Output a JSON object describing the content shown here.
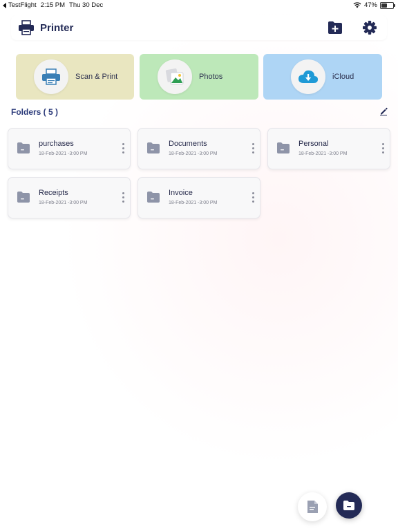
{
  "status_bar": {
    "back_app": "TestFlight",
    "time": "2:15 PM",
    "date": "Thu 30 Dec",
    "battery": "47%",
    "battery_level": 0.47
  },
  "header": {
    "title": "Printer",
    "logo_icon": "printer-icon",
    "add_folder_icon": "folder-plus-icon",
    "settings_icon": "gear-icon",
    "accent": "#232a56"
  },
  "quick_actions": [
    {
      "label": "Scan & Print",
      "icon": "printer-icon",
      "color": "#e9e6c0"
    },
    {
      "label": "Photos",
      "icon": "photos-icon",
      "color": "#bde8b9"
    },
    {
      "label": "iCloud",
      "icon": "cloud-download-icon",
      "color": "#aed5f5"
    }
  ],
  "folders": {
    "title": "Folders ( 5 )",
    "edit_icon": "pencil-icon",
    "items": [
      {
        "name": "purchases",
        "date": "18-Feb-2021 -3:00 PM"
      },
      {
        "name": "Documents",
        "date": "18-Feb-2021 -3:00 PM"
      },
      {
        "name": "Personal",
        "date": "18-Feb-2021 -3:00 PM"
      },
      {
        "name": "Receipts",
        "date": "18-Feb-2021 -3:00 PM"
      },
      {
        "name": "Invoice",
        "date": "18-Feb-2021 -3:00 PM"
      }
    ]
  },
  "fabs": {
    "document_icon": "document-icon",
    "folder_icon": "folder-icon"
  }
}
